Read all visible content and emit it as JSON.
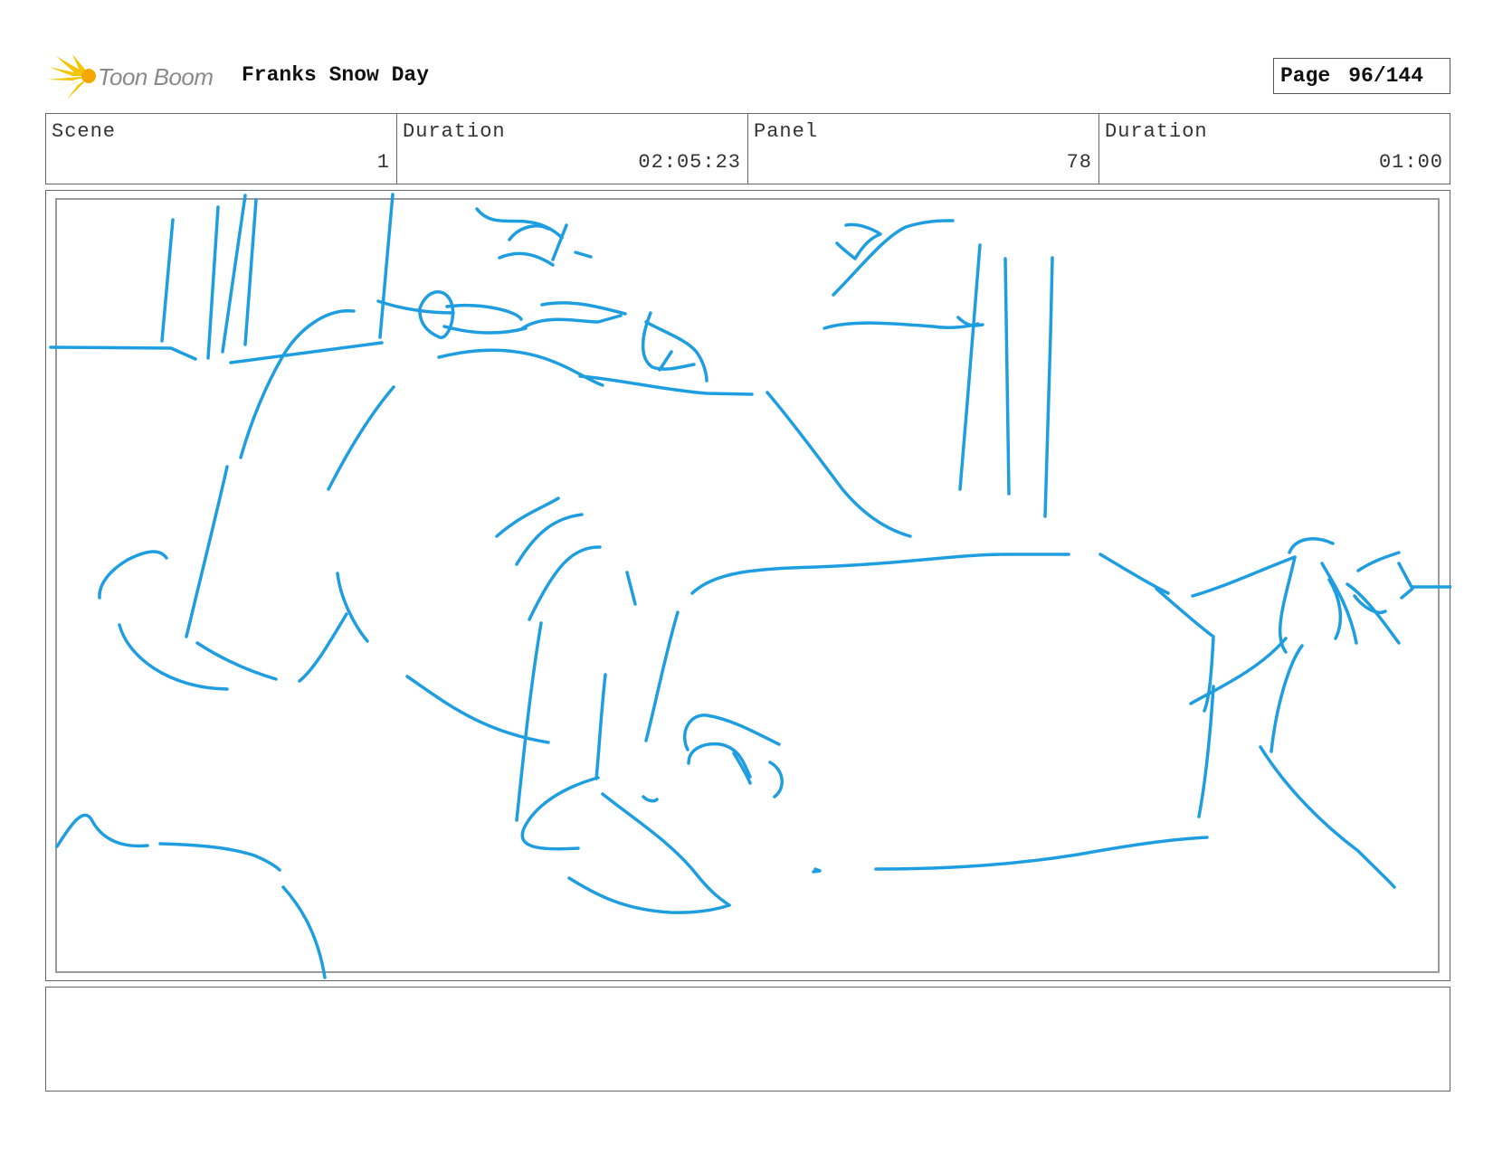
{
  "header": {
    "logo_text": "Toon Boom",
    "project_title": "Franks Snow Day",
    "page_label": "Page",
    "page_number": "96/144"
  },
  "info": {
    "scene_label": "Scene",
    "scene_value": "1",
    "scene_duration_label": "Duration",
    "scene_duration_value": "02:05:23",
    "panel_label": "Panel",
    "panel_value": "78",
    "panel_duration_label": "Duration",
    "panel_duration_value": "01:00"
  },
  "notes": {
    "text": ""
  },
  "colors": {
    "sketch_stroke": "#1e9ee0",
    "logo_yellow": "#f5c400",
    "border": "#666666"
  }
}
